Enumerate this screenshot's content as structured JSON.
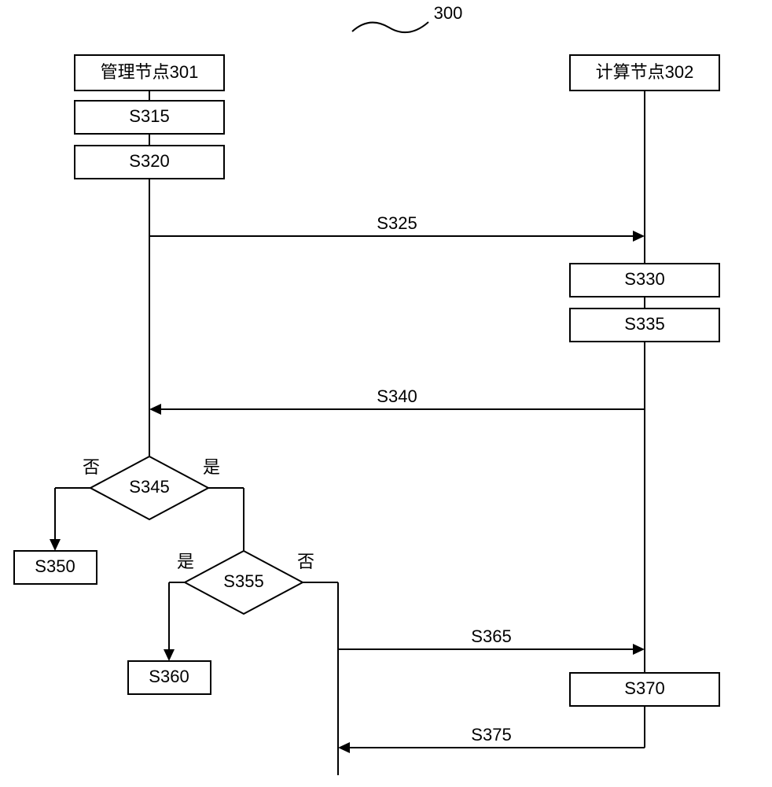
{
  "diagram_label": "300",
  "nodes": {
    "manage_node": "管理节点301",
    "compute_node": "计算节点302",
    "s315": "S315",
    "s320": "S320",
    "s325": "S325",
    "s330": "S330",
    "s335": "S335",
    "s340": "S340",
    "s345": "S345",
    "s350": "S350",
    "s355": "S355",
    "s360": "S360",
    "s365": "S365",
    "s370": "S370",
    "s375": "S375"
  },
  "branches": {
    "no": "否",
    "yes": "是"
  }
}
